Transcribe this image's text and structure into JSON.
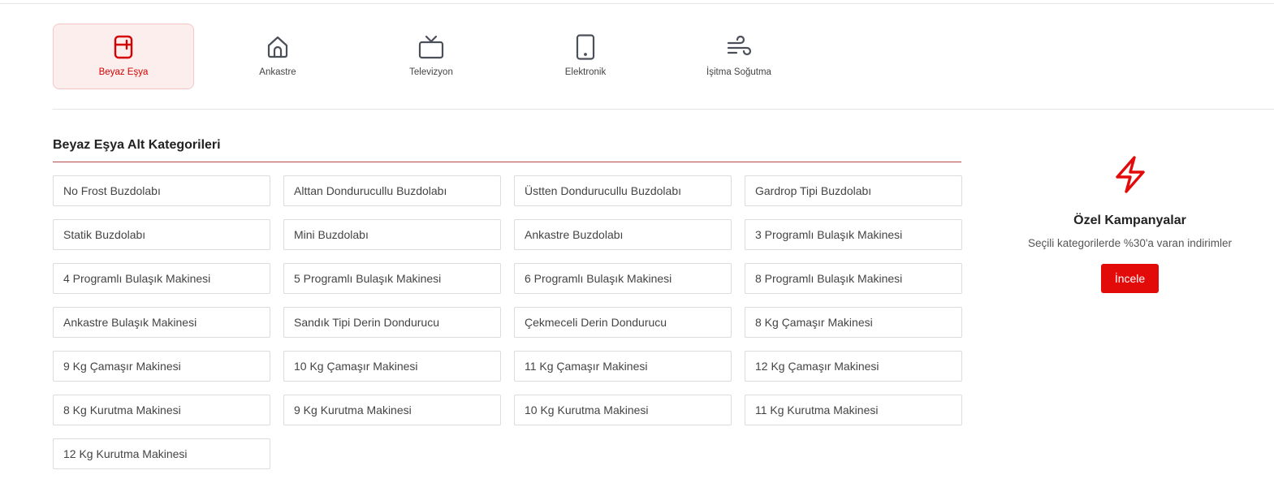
{
  "categories": [
    {
      "label": "Beyaz Eşya",
      "icon": "fridge-icon",
      "active": true
    },
    {
      "label": "Ankastre",
      "icon": "home-icon",
      "active": false
    },
    {
      "label": "Televizyon",
      "icon": "tv-icon",
      "active": false
    },
    {
      "label": "Elektronik",
      "icon": "phone-icon",
      "active": false
    },
    {
      "label": "İşitma Soğutma",
      "icon": "wind-icon",
      "active": false
    }
  ],
  "subcategories": {
    "title": "Beyaz Eşya Alt Kategorileri",
    "items": [
      "No Frost Buzdolabı",
      "Alttan Dondurucullu Buzdolabı",
      "Üstten Dondurucullu Buzdolabı",
      "Gardrop Tipi Buzdolabı",
      "Statik Buzdolabı",
      "Mini Buzdolabı",
      "Ankastre Buzdolabı",
      "3 Programlı Bulaşık Makinesi",
      "4 Programlı Bulaşık Makinesi",
      "5 Programlı Bulaşık Makinesi",
      "6 Programlı Bulaşık Makinesi",
      "8 Programlı Bulaşık Makinesi",
      "Ankastre Bulaşık Makinesi",
      "Sandık Tipi Derin Dondurucu",
      "Çekmeceli Derin Dondurucu",
      "8 Kg Çamaşır Makinesi",
      "9 Kg Çamaşır Makinesi",
      "10 Kg Çamaşır Makinesi",
      "11 Kg Çamaşır Makinesi",
      "12 Kg Çamaşır Makinesi",
      "8 Kg Kurutma Makinesi",
      "9 Kg Kurutma Makinesi",
      "10 Kg Kurutma Makinesi",
      "11 Kg Kurutma Makinesi",
      "12 Kg Kurutma Makinesi"
    ]
  },
  "promo": {
    "icon": "lightning-icon",
    "title": "Özel Kampanyalar",
    "description": "Seçili kategorilerde %30'a varan indirimler",
    "button_label": "İncele"
  },
  "colors": {
    "accent": "#e30a0a",
    "active_bg": "#fdeeee",
    "icon_gray": "#4a4f58"
  }
}
